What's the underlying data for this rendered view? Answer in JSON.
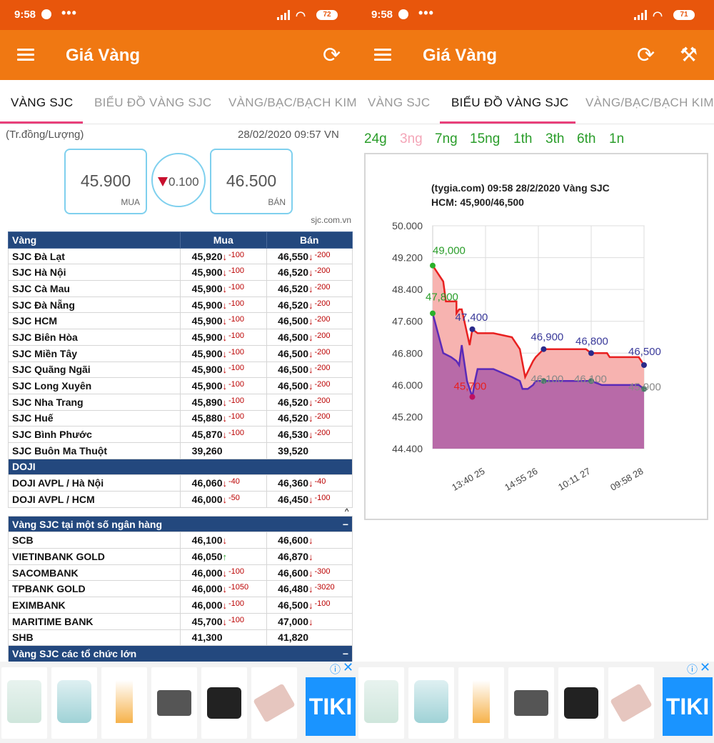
{
  "status": {
    "time": "9:58",
    "dots": "•••",
    "battery_left": "72",
    "battery_right": "71"
  },
  "appbar": {
    "title": "Giá Vàng"
  },
  "tabs": [
    "VÀNG SJC",
    "BIỂU ĐỒ VÀNG SJC",
    "VÀNG/BẠC/BẠCH KIM"
  ],
  "summary": {
    "unit": "(Tr.đồng/Lượng)",
    "datetime": "28/02/2020 09:57 VN",
    "buy": "45.900",
    "buy_label": "MUA",
    "change": "0.100",
    "sell": "46.500",
    "sell_label": "BÁN",
    "source": "sjc.com.vn"
  },
  "table": {
    "headers": [
      "Vàng",
      "Mua",
      "Bán"
    ],
    "sjc_rows": [
      {
        "name": "SJC Đà Lạt",
        "buy": "45,920",
        "buy_chg": "-100",
        "sell": "46,550",
        "sell_chg": "-200"
      },
      {
        "name": "SJC Hà Nội",
        "buy": "45,900",
        "buy_chg": "-100",
        "sell": "46,520",
        "sell_chg": "-200"
      },
      {
        "name": "SJC Cà Mau",
        "buy": "45,900",
        "buy_chg": "-100",
        "sell": "46,520",
        "sell_chg": "-200"
      },
      {
        "name": "SJC Đà Nẵng",
        "buy": "45,900",
        "buy_chg": "-100",
        "sell": "46,520",
        "sell_chg": "-200"
      },
      {
        "name": "SJC HCM",
        "buy": "45,900",
        "buy_chg": "-100",
        "sell": "46,500",
        "sell_chg": "-200"
      },
      {
        "name": "SJC Biên Hòa",
        "buy": "45,900",
        "buy_chg": "-100",
        "sell": "46,500",
        "sell_chg": "-200"
      },
      {
        "name": "SJC Miền Tây",
        "buy": "45,900",
        "buy_chg": "-100",
        "sell": "46,500",
        "sell_chg": "-200"
      },
      {
        "name": "SJC Quãng Ngãi",
        "buy": "45,900",
        "buy_chg": "-100",
        "sell": "46,500",
        "sell_chg": "-200"
      },
      {
        "name": "SJC Long Xuyên",
        "buy": "45,900",
        "buy_chg": "-100",
        "sell": "46,500",
        "sell_chg": "-200"
      },
      {
        "name": "SJC Nha Trang",
        "buy": "45,890",
        "buy_chg": "-100",
        "sell": "46,520",
        "sell_chg": "-200"
      },
      {
        "name": "SJC Huế",
        "buy": "45,880",
        "buy_chg": "-100",
        "sell": "46,520",
        "sell_chg": "-200"
      },
      {
        "name": "SJC Bình Phước",
        "buy": "45,870",
        "buy_chg": "-100",
        "sell": "46,530",
        "sell_chg": "-200"
      },
      {
        "name": "SJC Buôn Ma Thuột",
        "buy": "39,260",
        "buy_chg": "",
        "sell": "39,520",
        "sell_chg": ""
      }
    ],
    "doji_title": "DOJI",
    "doji_rows": [
      {
        "name": "DOJI AVPL / Hà Nội",
        "buy": "46,060",
        "buy_chg": "-40",
        "sell": "46,360",
        "sell_chg": "-40"
      },
      {
        "name": "DOJI AVPL / HCM",
        "buy": "46,000",
        "buy_chg": "-50",
        "sell": "46,450",
        "sell_chg": "-100"
      }
    ],
    "bank_title": "Vàng SJC tại một số ngân hàng",
    "bank_rows": [
      {
        "name": "SCB",
        "buy": "46,100",
        "buy_chg": "",
        "buy_dir": "down",
        "sell": "46,600",
        "sell_chg": "",
        "sell_dir": "down"
      },
      {
        "name": "VIETINBANK GOLD",
        "buy": "46,050",
        "buy_chg": "",
        "buy_dir": "up",
        "sell": "46,870",
        "sell_chg": "",
        "sell_dir": "down"
      },
      {
        "name": "SACOMBANK",
        "buy": "46,000",
        "buy_chg": "-100",
        "buy_dir": "down",
        "sell": "46,600",
        "sell_chg": "-300",
        "sell_dir": "down"
      },
      {
        "name": "TPBANK GOLD",
        "buy": "46,000",
        "buy_chg": "-1050",
        "buy_dir": "down",
        "sell": "46,480",
        "sell_chg": "-3020",
        "sell_dir": "down"
      },
      {
        "name": "EXIMBANK",
        "buy": "46,000",
        "buy_chg": "-100",
        "buy_dir": "down",
        "sell": "46,500",
        "sell_chg": "-100",
        "sell_dir": "down"
      },
      {
        "name": "MARITIME BANK",
        "buy": "45,700",
        "buy_chg": "-100",
        "buy_dir": "down",
        "sell": "47,000",
        "sell_chg": "",
        "sell_dir": "down"
      },
      {
        "name": "SHB",
        "buy": "41,300",
        "buy_chg": "",
        "buy_dir": "",
        "sell": "41,820",
        "sell_chg": "",
        "sell_dir": ""
      }
    ],
    "org_title": "Vàng SJC các tổ chức lớn",
    "minus": "−",
    "caret": "^"
  },
  "ads": {
    "tiki": "TIKI",
    "info": "ⓘ",
    "close": "✕"
  },
  "ranges": [
    "24g",
    "3ng",
    "7ng",
    "15ng",
    "1th",
    "3th",
    "6th",
    "1n"
  ],
  "colors": {
    "sell_line": "#e82020",
    "buy_line": "#5a2ab8",
    "sell_fill": "#f7b3b0",
    "buy_fill": "#b86aa8",
    "accent": "#f07812"
  },
  "chart_data": {
    "type": "area",
    "title": "(tygia.com) 09:58 28/2/2020    Vàng SJC",
    "subtitle": "HCM: 45,900/46,500",
    "ylim": [
      44.4,
      50.0
    ],
    "yticks": [
      "50.000",
      "49.200",
      "48.400",
      "47.600",
      "46.800",
      "46.000",
      "45.200",
      "44.400"
    ],
    "xticks": [
      "13:40 25",
      "14:55 26",
      "10:11 27",
      "09:58 28"
    ],
    "xtick_pos": [
      1.0,
      2.0,
      3.0,
      4.0
    ],
    "series": [
      {
        "name": "sell",
        "points": [
          [
            0,
            49.0
          ],
          [
            0.2,
            48.6
          ],
          [
            0.25,
            48.1
          ],
          [
            0.45,
            48.1
          ],
          [
            0.45,
            47.8
          ],
          [
            0.5,
            47.9
          ],
          [
            0.55,
            47.9
          ],
          [
            0.65,
            47.3
          ],
          [
            0.7,
            47.0
          ],
          [
            0.75,
            47.4
          ],
          [
            0.85,
            47.3
          ],
          [
            1.15,
            47.3
          ],
          [
            1.5,
            47.2
          ],
          [
            1.65,
            46.9
          ],
          [
            1.75,
            46.2
          ],
          [
            1.9,
            46.6
          ],
          [
            1.95,
            46.7
          ],
          [
            2.1,
            46.9
          ],
          [
            2.9,
            46.9
          ],
          [
            3.0,
            46.8
          ],
          [
            3.3,
            46.8
          ],
          [
            3.35,
            46.7
          ],
          [
            3.9,
            46.7
          ],
          [
            4.0,
            46.5
          ]
        ]
      },
      {
        "name": "buy",
        "points": [
          [
            0,
            47.8
          ],
          [
            0.2,
            46.8
          ],
          [
            0.35,
            46.7
          ],
          [
            0.45,
            46.6
          ],
          [
            0.5,
            46.5
          ],
          [
            0.55,
            47.0
          ],
          [
            0.65,
            46.1
          ],
          [
            0.75,
            45.7
          ],
          [
            0.8,
            46.1
          ],
          [
            0.85,
            46.4
          ],
          [
            1.15,
            46.4
          ],
          [
            1.5,
            46.2
          ],
          [
            1.65,
            46.1
          ],
          [
            1.7,
            45.9
          ],
          [
            1.8,
            45.9
          ],
          [
            1.9,
            46.0
          ],
          [
            1.95,
            46.1
          ],
          [
            2.1,
            46.1
          ],
          [
            2.95,
            46.1
          ],
          [
            3.0,
            46.1
          ],
          [
            3.2,
            46.0
          ],
          [
            3.3,
            46.0
          ],
          [
            3.9,
            46.0
          ],
          [
            4.0,
            45.9
          ]
        ]
      }
    ],
    "annotations": [
      {
        "text": "49,000",
        "x": 0,
        "y": 49.0,
        "color": "#2a9d2a"
      },
      {
        "text": "47,800",
        "x": 0,
        "y": 47.8,
        "color": "#2a9d2a"
      },
      {
        "text": "47,400",
        "x": 0.75,
        "y": 47.4,
        "color": "#3a3a9a"
      },
      {
        "text": "45,700",
        "x": 0.75,
        "y": 45.7,
        "color": "#e82020"
      },
      {
        "text": "46,900",
        "x": 2.1,
        "y": 46.9,
        "color": "#3a3a9a"
      },
      {
        "text": "46,100",
        "x": 2.1,
        "y": 46.1,
        "color": "#888888"
      },
      {
        "text": "46,800",
        "x": 3.0,
        "y": 46.8,
        "color": "#3a3a9a"
      },
      {
        "text": "46,100",
        "x": 3.0,
        "y": 46.1,
        "color": "#888888"
      },
      {
        "text": "46,500",
        "x": 4.0,
        "y": 46.5,
        "color": "#3a3a9a"
      },
      {
        "text": "45,900",
        "x": 4.0,
        "y": 45.9,
        "color": "#888888"
      }
    ]
  }
}
